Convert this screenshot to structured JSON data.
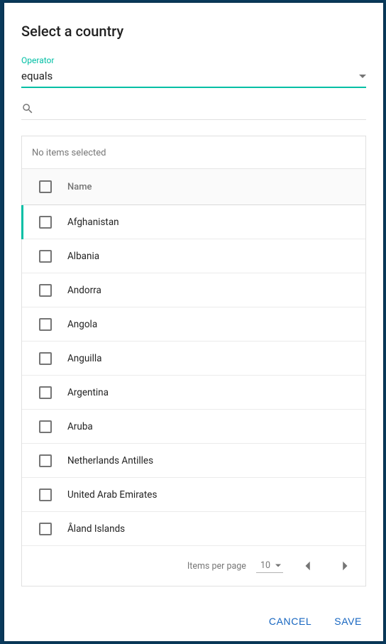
{
  "title": "Select a country",
  "operator": {
    "label": "Operator",
    "value": "equals"
  },
  "search": {
    "value": ""
  },
  "panel": {
    "status": "No items selected",
    "column_header": "Name",
    "rows": [
      "Afghanistan",
      "Albania",
      "Andorra",
      "Angola",
      "Anguilla",
      "Argentina",
      "Aruba",
      "Netherlands Antilles",
      "United Arab Emirates",
      "Åland Islands"
    ]
  },
  "pagination": {
    "label": "Items per page",
    "size": "10"
  },
  "actions": {
    "cancel": "Cancel",
    "save": "Save"
  }
}
